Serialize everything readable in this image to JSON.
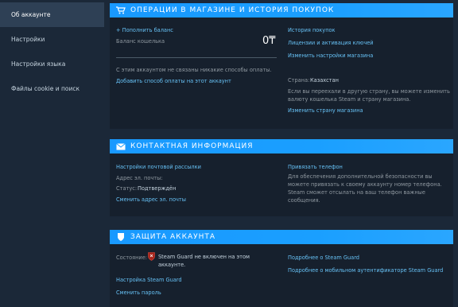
{
  "sidebar": {
    "items": [
      {
        "label": "Об аккаунте",
        "active": true
      },
      {
        "label": "Настройки"
      },
      {
        "label": "Настройки языка"
      },
      {
        "label": "Файлы cookie и поиск"
      }
    ]
  },
  "store": {
    "title": "ОПЕРАЦИИ В МАГАЗИНЕ И ИСТОРИЯ ПОКУПОК",
    "icon": "cart-icon",
    "add_funds": "+ Пополнить баланс",
    "balance_label": "Баланс кошелька",
    "balance_value": "0₸",
    "no_payment_text": "С этим аккаунтом не связаны никакие способы оплаты.",
    "add_payment_link": "Добавить способ оплаты на этот аккаунт",
    "purchase_history": "История покупок",
    "licenses": "Лицензии и активация ключей",
    "store_prefs": "Изменить настройки магазина",
    "country_label": "Страна:",
    "country_value": "Казахстан",
    "country_desc_1": "Если вы переехали в другую страну, вы можете изменить",
    "country_desc_2": "валюту кошелька Steam и страну магазина.",
    "change_country": "Изменить страну магазина"
  },
  "contact": {
    "title": "КОНТАКТНАЯ ИНФОРМАЦИЯ",
    "icon": "envelope-icon",
    "email_prefs": "Настройки почтовой рассылки",
    "email_label": "Адрес эл. почты:",
    "status_label": "Статус:",
    "status_value": "Подтверждён",
    "change_email": "Сменить адрес эл. почты",
    "add_phone": "Привязать телефон",
    "phone_desc": [
      "Для обеспечения дополнительной безопасности вы",
      "можете привязать к своему аккаунту номер телефона.",
      "Steam сможет отсылать на ваш телефон важные",
      "сообщения."
    ]
  },
  "security": {
    "title": "ЗАЩИТА АККАУНТА",
    "icon": "shield-icon",
    "status_label": "Состояние:",
    "guard_status_1": "Steam Guard не включен на этом",
    "guard_status_2": "аккаунте.",
    "guard_settings": "Настройка Steam Guard",
    "change_password": "Сменить пароль",
    "more_guard": "Подробнее о Steam Guard",
    "more_mobile": "Подробнее о мобильном аутентификаторе Steam Guard"
  }
}
